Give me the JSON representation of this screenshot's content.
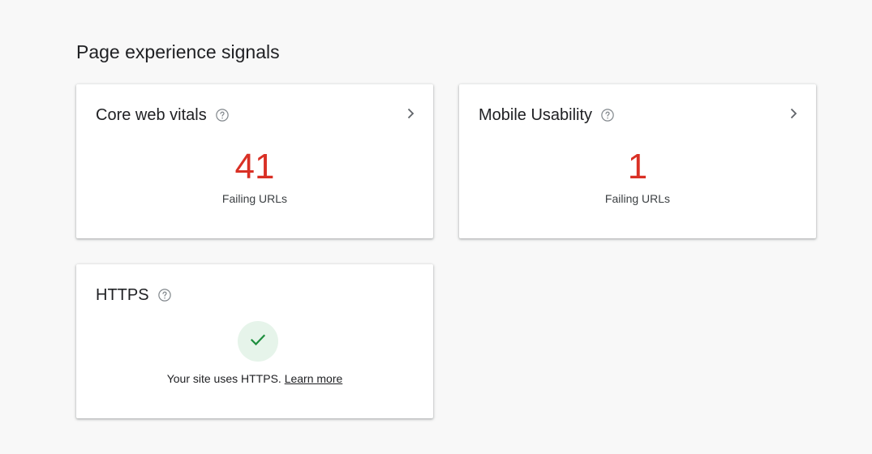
{
  "page": {
    "title": "Page experience signals"
  },
  "cards": {
    "core_web_vitals": {
      "title": "Core web vitals",
      "help_icon": "help-circle-outline-icon",
      "chevron_icon": "chevron-right-icon",
      "value": "41",
      "value_label": "Failing URLs",
      "value_color": "#d93025"
    },
    "mobile_usability": {
      "title": "Mobile Usability",
      "help_icon": "help-circle-outline-icon",
      "chevron_icon": "chevron-right-icon",
      "value": "1",
      "value_label": "Failing URLs",
      "value_color": "#d93025"
    },
    "https": {
      "title": "HTTPS",
      "help_icon": "help-circle-outline-icon",
      "status_icon": "check-icon",
      "status_color": "#1e8e3e",
      "status_text": "Your site uses HTTPS.",
      "link_text": "Learn more"
    }
  }
}
